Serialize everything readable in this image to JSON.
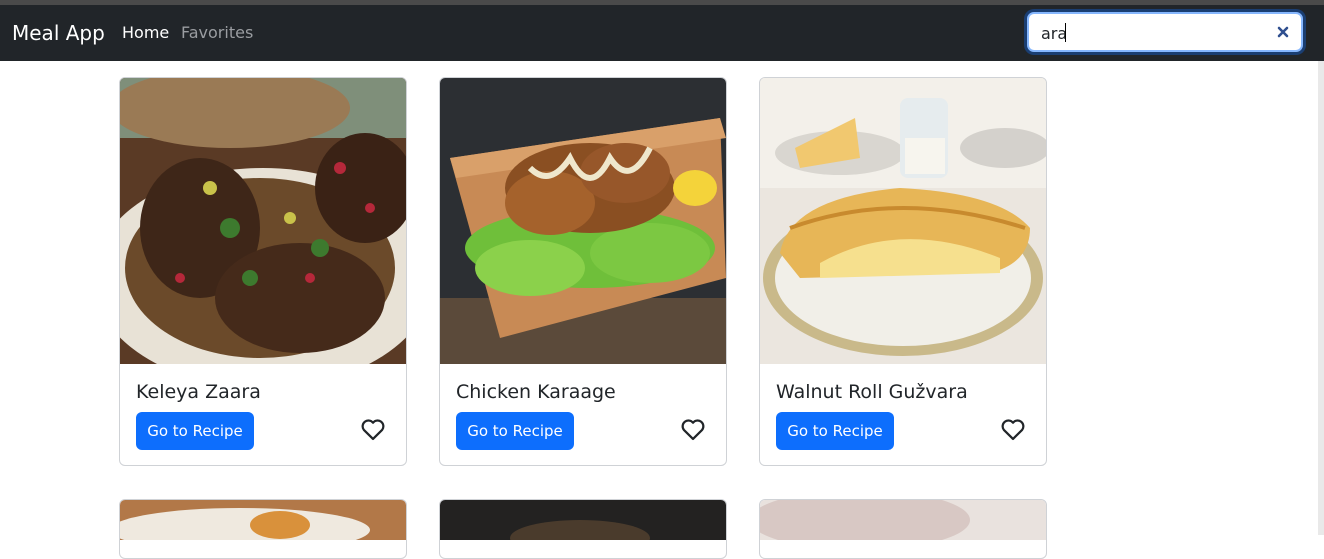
{
  "navbar": {
    "brand": "Meal App",
    "links": [
      {
        "label": "Home",
        "active": true
      },
      {
        "label": "Favorites",
        "active": false
      }
    ],
    "search": {
      "value": "ara",
      "placeholder": ""
    },
    "clear_icon": "close-icon"
  },
  "colors": {
    "navbar_bg": "#212529",
    "primary": "#0d6efd",
    "card_border": "#cfd2d6"
  },
  "meals": [
    {
      "name": "Keleya Zaara",
      "button_label": "Go to Recipe",
      "favorite_icon": "heart-outline-icon"
    },
    {
      "name": "Chicken Karaage",
      "button_label": "Go to Recipe",
      "favorite_icon": "heart-outline-icon"
    },
    {
      "name": "Walnut Roll Gužvara",
      "button_label": "Go to Recipe",
      "favorite_icon": "heart-outline-icon"
    }
  ]
}
